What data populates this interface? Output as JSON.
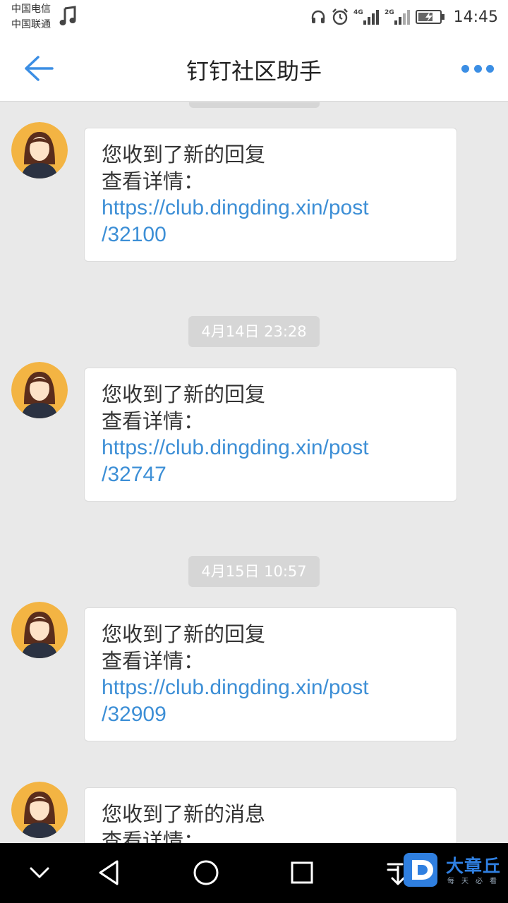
{
  "status_bar": {
    "carrier_1": "中国电信",
    "carrier_2": "中国联通",
    "network_1": "4G",
    "network_2": "2G",
    "time": "14:45",
    "icons": [
      "music-icon",
      "headset-icon",
      "alarm-icon",
      "signal-4g-icon",
      "signal-2g-icon",
      "battery-charging-icon"
    ]
  },
  "header": {
    "title": "钉钉社区助手",
    "back_icon": "back-arrow-icon",
    "more_icon": "more-dots-icon",
    "accent_color": "#3b8ee4"
  },
  "messages": [
    {
      "timestamp": "",
      "line1": "您收到了新的回复",
      "line2": "查看详情：",
      "link_part1": "https://club.dingding.xin/post",
      "link_part2": "/32100"
    },
    {
      "timestamp": "4月14日 23:28",
      "line1": "您收到了新的回复",
      "line2": "查看详情：",
      "link_part1": "https://club.dingding.xin/post",
      "link_part2": "/32747"
    },
    {
      "timestamp": "4月15日 10:57",
      "line1": "您收到了新的回复",
      "line2": "查看详情：",
      "link_part1": "https://club.dingding.xin/post",
      "link_part2": "/32909"
    },
    {
      "timestamp": "",
      "line1": "您收到了新的消息",
      "line2": "查看详情：",
      "link_part1": "",
      "link_part2": ""
    }
  ],
  "nav_bar": {
    "icons": [
      "chevron-down-icon",
      "nav-back-icon",
      "nav-home-icon",
      "nav-recent-icon",
      "download-icon"
    ]
  },
  "watermark": {
    "title": "大章丘",
    "subtitle": "每天必看",
    "color": "#2f7fe0"
  }
}
